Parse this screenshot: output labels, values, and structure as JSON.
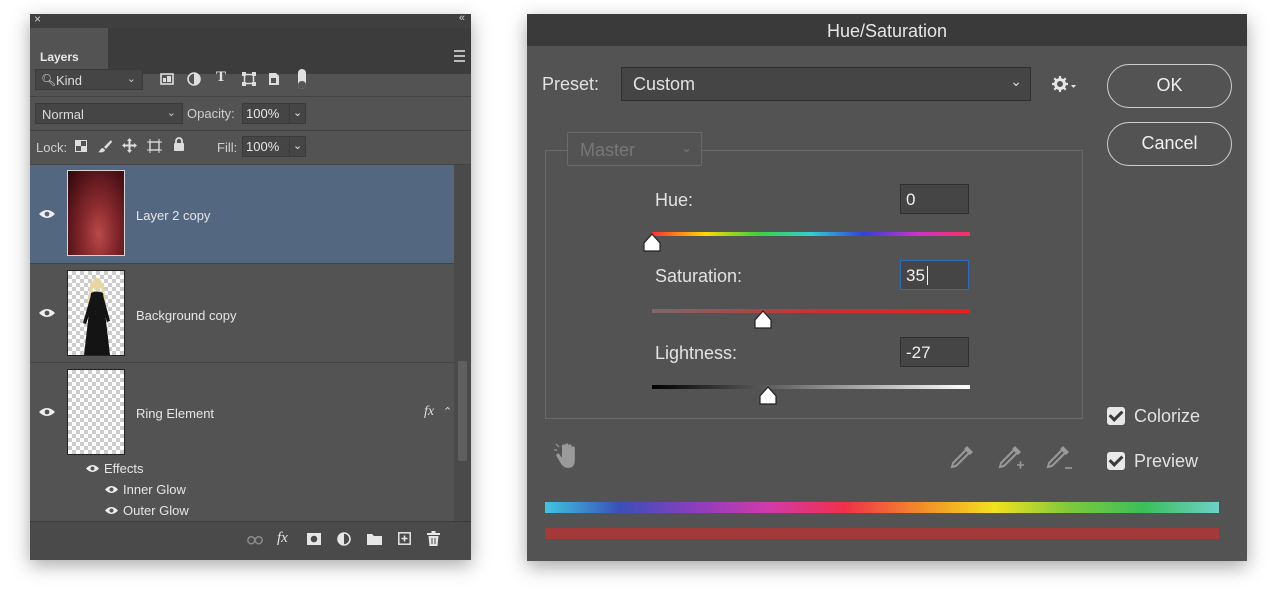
{
  "layers_panel": {
    "close_glyph": "×",
    "collapse_glyph": "«",
    "tab_label": "Layers",
    "filter": {
      "label": "Kind"
    },
    "blend_mode": "Normal",
    "opacity_label": "Opacity:",
    "opacity_value": "100%",
    "lock_label": "Lock:",
    "fill_label": "Fill:",
    "fill_value": "100%",
    "layers": [
      {
        "name": "Layer 2 copy",
        "selected": true
      },
      {
        "name": "Background copy",
        "selected": false
      },
      {
        "name": "Ring Element",
        "selected": false,
        "fx": "fx"
      }
    ],
    "effects": {
      "label": "Effects",
      "items": [
        "Inner Glow",
        "Outer Glow"
      ]
    }
  },
  "hue_sat": {
    "title": "Hue/Saturation",
    "preset_label": "Preset:",
    "preset_value": "Custom",
    "ok_label": "OK",
    "cancel_label": "Cancel",
    "channel": "Master",
    "hue_label": "Hue:",
    "hue_value": "0",
    "saturation_label": "Saturation:",
    "saturation_value": "35",
    "lightness_label": "Lightness:",
    "lightness_value": "-27",
    "colorize_label": "Colorize",
    "colorize_checked": true,
    "preview_label": "Preview",
    "preview_checked": true,
    "colors": {
      "colorize_bar": "#a33a3a",
      "accent": "#2e6cc0"
    }
  }
}
